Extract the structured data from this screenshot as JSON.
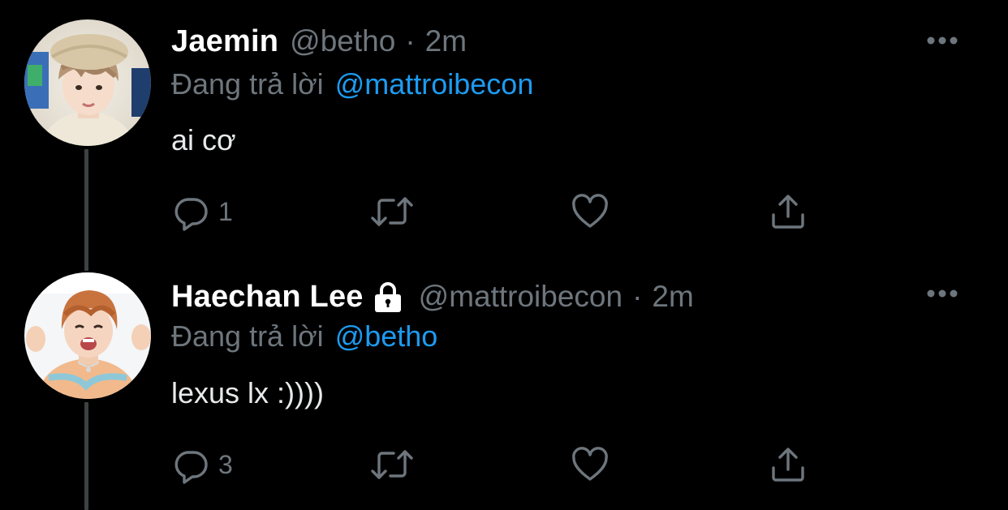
{
  "thread": {
    "tweets": [
      {
        "display_name": "Jaemin",
        "handle": "@betho",
        "separator": "·",
        "time": "2m",
        "replying_prefix": "Đang trả lời",
        "replying_to": "@mattroibecon",
        "text": "ai cơ",
        "reply_count": "1",
        "retweet_count": "",
        "like_count": "",
        "protected": false
      },
      {
        "display_name": "Haechan Lee",
        "handle": "@mattroibecon",
        "separator": "·",
        "time": "2m",
        "replying_prefix": "Đang trả lời",
        "replying_to": "@betho",
        "text": "lexus lx :))))",
        "reply_count": "3",
        "retweet_count": "",
        "like_count": "",
        "protected": true
      }
    ]
  },
  "icons": {
    "reply": "speech-bubble-icon",
    "retweet": "retweet-arrows-icon",
    "like": "heart-icon",
    "share": "share-upload-icon",
    "more": "more-dots-icon",
    "protected": "lock-icon"
  },
  "colors": {
    "background": "#000000",
    "text": "#e7e9ea",
    "muted": "#6e767d",
    "accent": "#1d9bf0",
    "thread_line": "#3d4144"
  }
}
